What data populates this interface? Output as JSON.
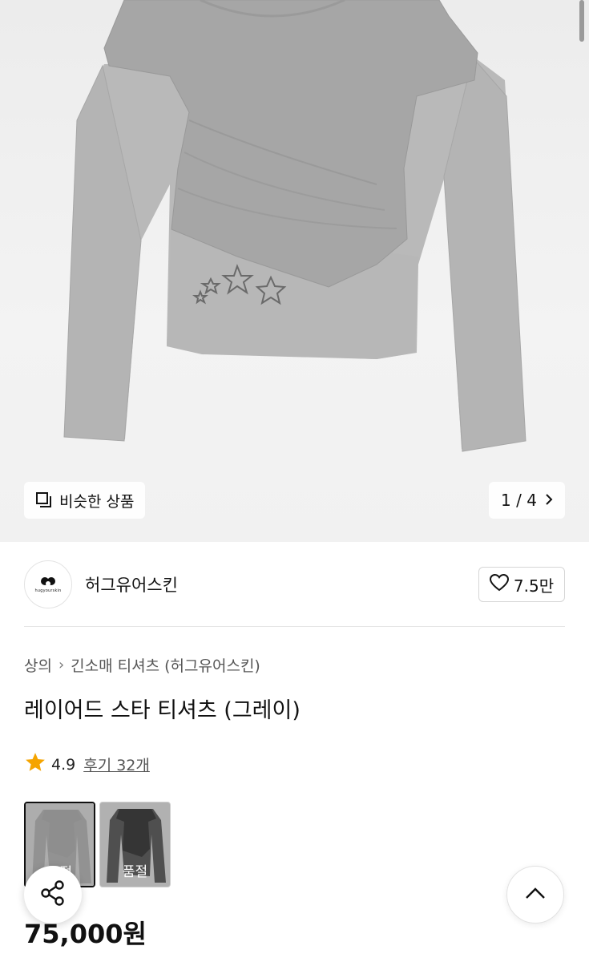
{
  "hero": {
    "similar_label": "비슷한 상품",
    "pager": "1 / 4"
  },
  "brand": {
    "name": "허그유어스킨",
    "logo_text": "hugyourskin",
    "likes": "7.5만"
  },
  "product": {
    "breadcrumb": [
      "상의",
      "긴소매 티셔츠 (허그유어스킨)"
    ],
    "title": "레이어드 스타 티셔츠 (그레이)",
    "rating": "4.9",
    "reviews": "후기 32개",
    "price": "75,000원"
  },
  "variants": [
    {
      "color": "gray",
      "sold_out_label": "품절",
      "selected": true
    },
    {
      "color": "black",
      "sold_out_label": "품절",
      "selected": false
    }
  ],
  "icons": {
    "similar": "similar-items-icon",
    "pager_next": "chevron-right-icon",
    "like": "heart-outline-icon",
    "rating": "star-icon",
    "share": "share-icon",
    "scroll_top": "chevron-up-icon"
  },
  "colors": {
    "star": "#f5a400",
    "shirt": "#a8a8a8"
  }
}
